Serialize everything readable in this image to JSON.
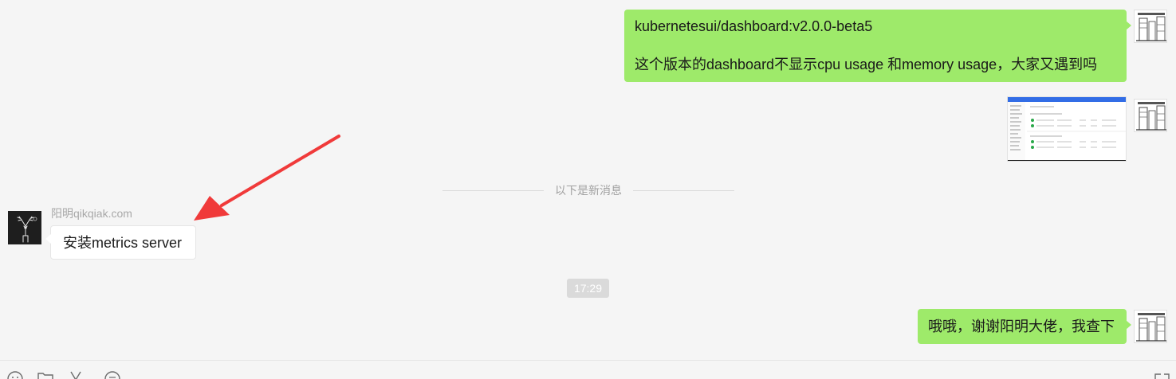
{
  "messages": {
    "m1": {
      "line1": "kubernetesui/dashboard:v2.0.0-beta5",
      "line2": "这个版本的dashboard不显示cpu usage 和memory usage，大家又遇到吗"
    },
    "divider_text": "以下是新消息",
    "sender_name": "阳明qikqiak.com",
    "m3": {
      "text": "安装metrics server"
    },
    "timestamp": "17:29",
    "m4": {
      "text": "哦哦，谢谢阳明大佬，我查下"
    }
  },
  "colors": {
    "my_bubble": "#9eea6a",
    "their_bubble": "#ffffff",
    "background": "#f5f5f5",
    "annotation_arrow": "#f03a3a"
  },
  "icons": [
    "emoji-icon",
    "folder-icon",
    "scissors-icon",
    "chat-bubble-icon",
    "expand-icon"
  ]
}
